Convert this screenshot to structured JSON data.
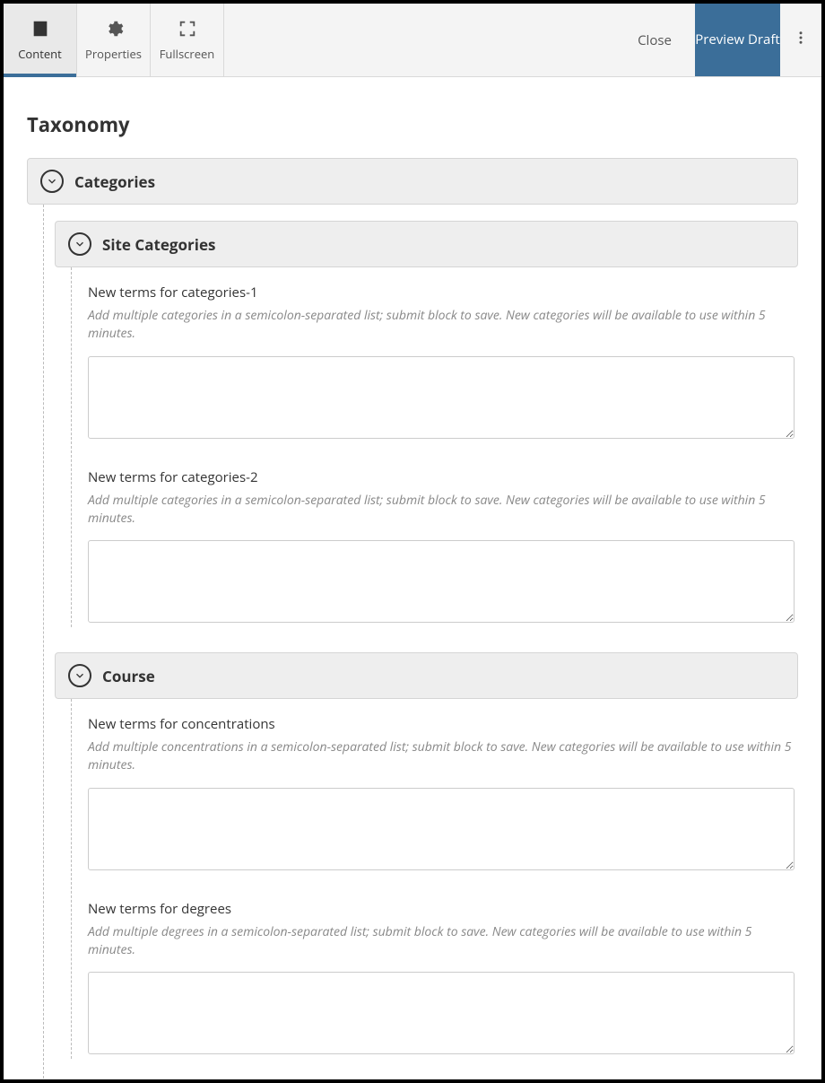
{
  "toolbar": {
    "tabs": [
      {
        "label": "Content",
        "icon": "doc",
        "active": true
      },
      {
        "label": "Properties",
        "icon": "gear",
        "active": false
      },
      {
        "label": "Fullscreen",
        "icon": "fullscreen",
        "active": false
      }
    ],
    "close_label": "Close",
    "preview_label": "Preview Draft"
  },
  "page": {
    "title": "Taxonomy"
  },
  "categories": {
    "title": "Categories",
    "site_categories": {
      "title": "Site Categories",
      "fields": [
        {
          "label": "New terms for categories-1",
          "hint": "Add multiple categories in a semicolon-separated list; submit block to save. New categories will be available to use within 5 minutes.",
          "value": ""
        },
        {
          "label": "New terms for categories-2",
          "hint": "Add multiple categories in a semicolon-separated list; submit block to save. New categories will be available to use within 5 minutes.",
          "value": ""
        }
      ]
    },
    "course": {
      "title": "Course",
      "fields": [
        {
          "label": "New terms for concentrations",
          "hint": "Add multiple concentrations in a semicolon-separated list; submit block to save. New categories will be available to use within 5 minutes.",
          "value": ""
        },
        {
          "label": "New terms for degrees",
          "hint": "Add multiple degrees in a semicolon-separated list; submit block to save. New categories will be available to use within 5 minutes.",
          "value": ""
        }
      ]
    }
  }
}
